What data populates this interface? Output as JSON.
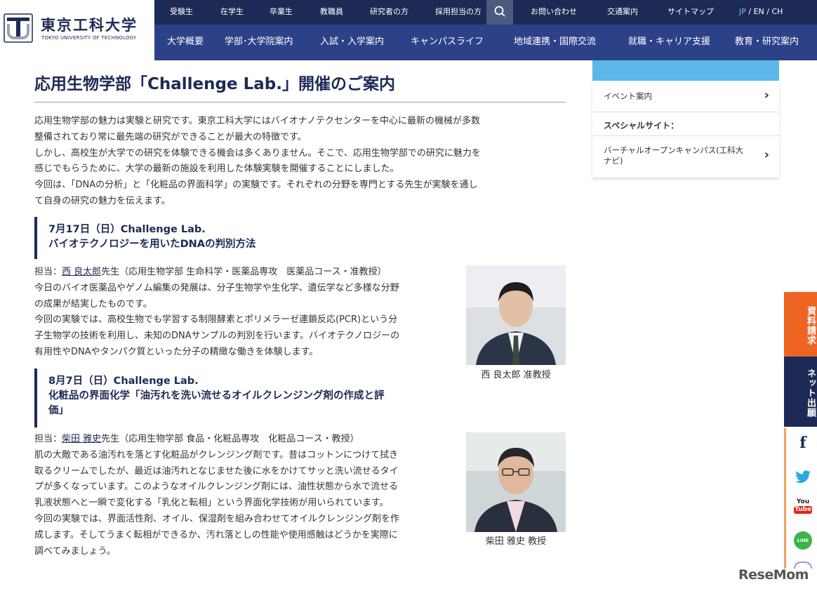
{
  "header": {
    "logo_text": "東京工科大学",
    "logo_subtext": "TOKYO UNIVERSITY OF TECHNOLOGY",
    "top_links": [
      "受験生",
      "在学生",
      "卒業生",
      "教職員",
      "研究者の方",
      "採用担当の方"
    ],
    "utility_links": [
      "お問い合わせ",
      "交通案内",
      "サイトマップ"
    ],
    "lang": {
      "jp": "JP",
      "en": "/ EN",
      "ch": "/ CH"
    },
    "main_nav": [
      "大学概要",
      "学部･大学院案内",
      "入試・入学案内",
      "キャンパスライフ",
      "地域連携・国際交流",
      "就職・キャリア支援",
      "教育・研究案内"
    ]
  },
  "article": {
    "title": "応用生物学部「Challenge Lab.」開催のご案内",
    "intro": [
      "応用生物学部の魅力は実験と研究です。東京工科大学にはバイオナノテクセンターを中心に最新の機械が多数",
      "整備されており常に最先端の研究ができることが最大の特徴です。",
      "しかし、高校生が大学での研究を体験できる機会は多くありません。そこで、応用生物学部での研究に魅力を",
      "感じでもらうために、大学の最新の施設を利用した体験実験を開催することにしました。",
      "今回は、「DNAの分析」と「化粧品の界面科学」の実験です。それぞれの分野を専門とする先生が実験を通し",
      "て自身の研究の魅力を伝えます。"
    ],
    "event1": {
      "heading": [
        "7月17日（日）Challenge Lab.",
        "バイオテクノロジーを用いたDNAの判別方法"
      ],
      "charge_prefix": "担当：",
      "teacher_link": "西 良太郎",
      "charge_suffix": "先生（応用生物学部 生命科学・医薬品専攻　医薬品コース・准教授）",
      "lines": [
        "今日のバイオ医薬品やゲノム編集の発展は、分子生物学や生化学、遺伝学など多様な分野",
        "の成果が結実したものです。",
        "今回の実験では、高校生物でも学習する制限酵素とポリメラーゼ連鎖反応(PCR)という分",
        "子生物学の技術を利用し、未知のDNAサンプルの判別を行います。バイオテクノロジーの",
        "有用性やDNAやタンパク質といった分子の精緻な働きを体験します。"
      ],
      "caption": "西 良太郎 准教授"
    },
    "event2": {
      "heading": [
        "8月7日（日）Challenge Lab.",
        "化粧品の界面化学「油汚れを洗い流せるオイルクレンジング剤の作成と評",
        "価」"
      ],
      "charge_prefix": "担当：",
      "teacher_link": "柴田 雅史",
      "charge_suffix": "先生（応用生物学部 食品・化粧品専攻　化粧品コース・教授）",
      "lines": [
        "肌の大敵である油汚れを落とす化粧品がクレンジング剤です。昔はコットンにつけて拭き",
        "取るクリームでしたが、最近は油汚れとなじませた後に水をかけてサッと洗い流せるタイ",
        "プが多くなっています。このようなオイルクレンジング剤には、油性状態から水で流せる",
        "乳液状態へと一瞬で変化する「乳化と転相」という界面化学技術が用いられています。",
        "今回の実験では、界面活性剤、オイル、保湿剤を組み合わせてオイルクレンジング剤を作",
        "成します。そしてうまく転相ができるか、汚れ落としの性能や使用感触はどうかを実際に",
        "調べてみましょう。"
      ],
      "caption": "柴田 雅史 教授"
    }
  },
  "sidebar": {
    "event_link": "イベント案内",
    "special_heading": "スペシャルサイト：",
    "special_link": [
      "バーチャルオープンキャンパス(工科大",
      "ナビ)"
    ]
  },
  "floating": {
    "request": "資料請求",
    "net_apply": "ネット出願",
    "facebook": "f",
    "youtube_top": "You",
    "youtube_bottom": "Tube",
    "line": "LINE"
  },
  "watermark": "ReseMom",
  "colors": {
    "navy": "#1d2a55",
    "nav_blue": "#2d4188",
    "orange": "#ee6423",
    "sky": "#5bb8e8"
  }
}
